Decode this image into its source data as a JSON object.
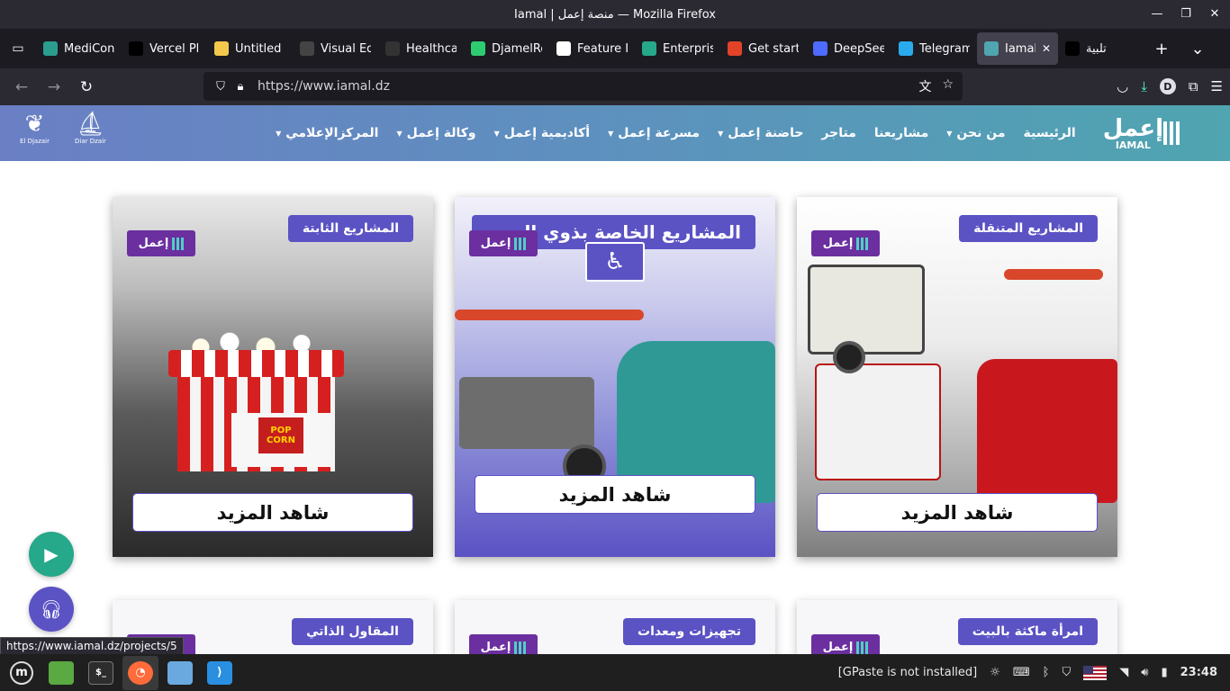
{
  "window": {
    "title": "Iamal | منصة إعمل — Mozilla Firefox"
  },
  "tabs": [
    {
      "label": "MediCon",
      "icon": "medicon-icon",
      "color": "#2a9d8f"
    },
    {
      "label": "Vercel Pl",
      "icon": "vercel-icon",
      "color": "#000000"
    },
    {
      "label": "Untitled",
      "icon": "smiley-icon",
      "color": "#f2c94c"
    },
    {
      "label": "Visual Ed",
      "icon": "visual-editor-icon",
      "color": "#444444"
    },
    {
      "label": "Healthca",
      "icon": "healthcare-icon",
      "color": "#333333"
    },
    {
      "label": "DjamelRe",
      "icon": "djamel-icon",
      "color": "#2ecc71"
    },
    {
      "label": "Feature I",
      "icon": "github-icon",
      "color": "#ffffff"
    },
    {
      "label": "Enterpris",
      "icon": "enterprise-icon",
      "color": "#26a88a"
    },
    {
      "label": "Get start",
      "icon": "gitlab-icon",
      "color": "#e24329"
    },
    {
      "label": "DeepSee",
      "icon": "deepseek-icon",
      "color": "#4d6bfe"
    },
    {
      "label": "Telegram",
      "icon": "telegram-icon",
      "color": "#2aabee"
    },
    {
      "label": "Iamal |",
      "icon": "iamal-icon",
      "color": "#4fa5b0",
      "active": true
    },
    {
      "label": "تلبية",
      "icon": "talbia-icon",
      "color": "#000000"
    }
  ],
  "navbar": {
    "url": "https://www.iamal.dz"
  },
  "site": {
    "brand_ar": "إعمل",
    "brand_en": "IAMAL",
    "menu": [
      {
        "label": "الرئيسية",
        "dropdown": false
      },
      {
        "label": "من نحن",
        "dropdown": true
      },
      {
        "label": "مشاريعنا",
        "dropdown": false
      },
      {
        "label": "متاجر",
        "dropdown": false
      },
      {
        "label": "حاضنة إعمل",
        "dropdown": true
      },
      {
        "label": "مسرعة إعمل",
        "dropdown": true
      },
      {
        "label": "أكاديمية إعمل",
        "dropdown": true
      },
      {
        "label": "وكالة إعمل",
        "dropdown": true
      },
      {
        "label": "المركزالإعلامي",
        "dropdown": true
      }
    ],
    "partners": [
      {
        "name": "Diar Dzair"
      },
      {
        "name": "El Djazair"
      }
    ]
  },
  "cards": [
    {
      "badge": "المشاريع الثابتة",
      "button": "شاهد المزيد",
      "logo_ar": "إعمل",
      "logo_en": "IAMAL",
      "kiosk_sign": "POP CORN"
    },
    {
      "badge": "المشاريع الخاصة بذوي الهمم",
      "button": "شاهد المزيد",
      "logo_ar": "إعمل",
      "logo_en": "IAMAL"
    },
    {
      "badge": "المشاريع المتنقلة",
      "button": "شاهد المزيد",
      "logo_ar": "إعمل",
      "logo_en": "IAMAL"
    }
  ],
  "cards_row2": [
    {
      "badge": "المقاول الذاتي"
    },
    {
      "badge": "تجهيزات ومعدات"
    },
    {
      "badge": "امرأة ماكثة بالبيت"
    }
  ],
  "status_link": "https://www.iamal.dz/projects/5",
  "taskbar": {
    "notice": "[GPaste is not installed]",
    "clock": "23:48"
  }
}
